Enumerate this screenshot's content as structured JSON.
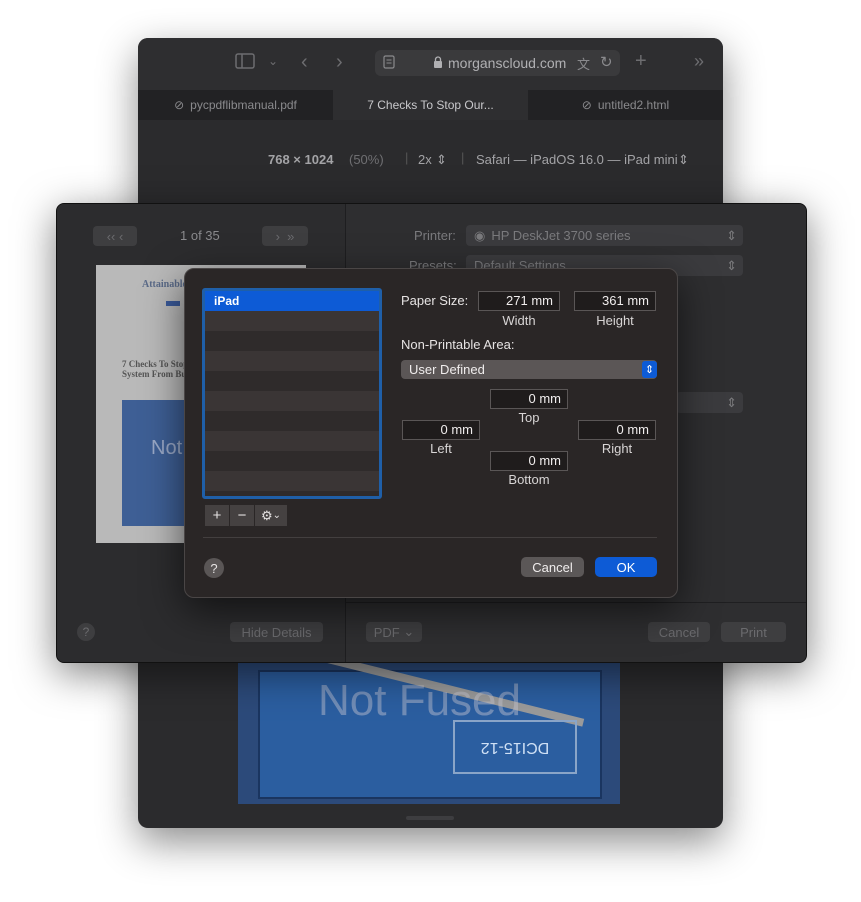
{
  "safari": {
    "url": "morganscloud.com",
    "tabs": [
      {
        "label": "pycpdflibmanual.pdf"
      },
      {
        "label": "7 Checks To Stop Our..."
      },
      {
        "label": "untitled2.html"
      }
    ],
    "responsive": {
      "dimensions": "768 × 1024",
      "zoom": "(50%)",
      "scale": "2x",
      "device": "Safari — iPadOS 16.0 — iPad mini"
    },
    "preview_watermark": "Not Fused",
    "battery_label": "DCI15-12"
  },
  "print_panel": {
    "page_indicator": "1 of 35",
    "printer_label": "Printer:",
    "printer_value": "HP DeskJet 3700 series",
    "presets_label": "Presets:",
    "presets_value": "Default Settings",
    "pdf_button": "PDF",
    "cancel_button": "Cancel",
    "print_button": "Print",
    "hide_details_button": "Hide Details",
    "help": "?",
    "thumb": {
      "site_title": "Attainable",
      "article_title": "7 Checks To Stop",
      "article_title2": "System From Bu",
      "watermark": "Not"
    }
  },
  "paper_dialog": {
    "list_items": [
      "iPad"
    ],
    "paper_size_label": "Paper Size:",
    "width_value": "271 mm",
    "width_caption": "Width",
    "height_value": "361 mm",
    "height_caption": "Height",
    "non_printable_label": "Non-Printable Area:",
    "area_select": "User Defined",
    "top_value": "0 mm",
    "top_caption": "Top",
    "left_value": "0 mm",
    "left_caption": "Left",
    "right_value": "0 mm",
    "right_caption": "Right",
    "bottom_value": "0 mm",
    "bottom_caption": "Bottom",
    "add": "+",
    "remove": "−",
    "help": "?",
    "cancel": "Cancel",
    "ok": "OK"
  },
  "colors": {
    "accent": "#0d5bd6",
    "list_focus": "#1f5fa8"
  }
}
